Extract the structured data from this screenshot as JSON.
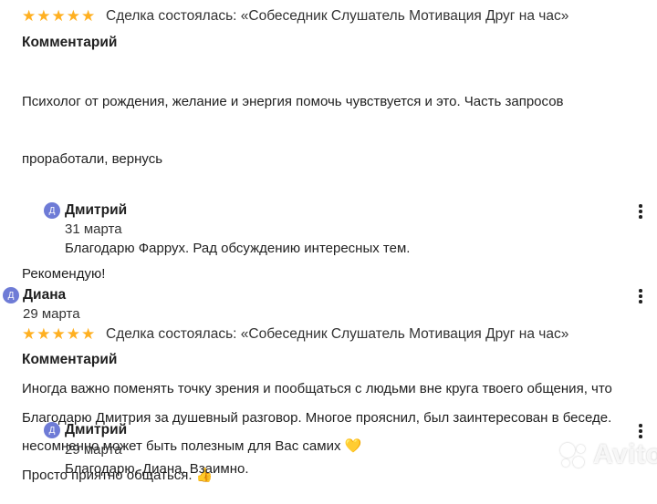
{
  "review1": {
    "rating": 5,
    "deal_text": "Сделка состоялась: «Собеседник Слушатель Мотивация Друг на час»",
    "comment_label": "Комментарий",
    "comment_lines": [
      "Психолог от рождения, желание и энергия помочь чувствуется и это. Часть запросов",
      "проработали, вернусь",
      "",
      "Рекомендую!",
      "",
      "Иногда важно поменять точку зрения и пообщаться с людьми вне круга твоего общения, что",
      "несомненно может быть полезным для Вас самих"
    ],
    "emoji": "💛",
    "reply": {
      "avatar_letter": "Д",
      "author": "Дмитрий",
      "date": "31 марта",
      "text": "Благодарю Фаррух. Рад обсуждению интересных тем."
    }
  },
  "review2": {
    "avatar_letter": "Д",
    "author": "Диана",
    "date": "29 марта",
    "rating": 5,
    "deal_text": "Сделка состоялась: «Собеседник Слушатель Мотивация Друг на час»",
    "comment_label": "Комментарий",
    "comment_lines": [
      "Благодарю Дмитрия за душевный разговор. Многое прояснил, был заинтересован в беседе.",
      "Просто приятно общаться."
    ],
    "emoji": "👍",
    "reply": {
      "avatar_letter": "Д",
      "author": "Дмитрий",
      "date": "29 марта",
      "text": "Благодарю, Диана. Взаимно."
    }
  },
  "watermark": "Avito",
  "colors": {
    "star": "#ffb021",
    "avatar": "#6e7bd6"
  },
  "icons": {
    "menu": "more-vertical-icon",
    "star": "star-icon"
  }
}
